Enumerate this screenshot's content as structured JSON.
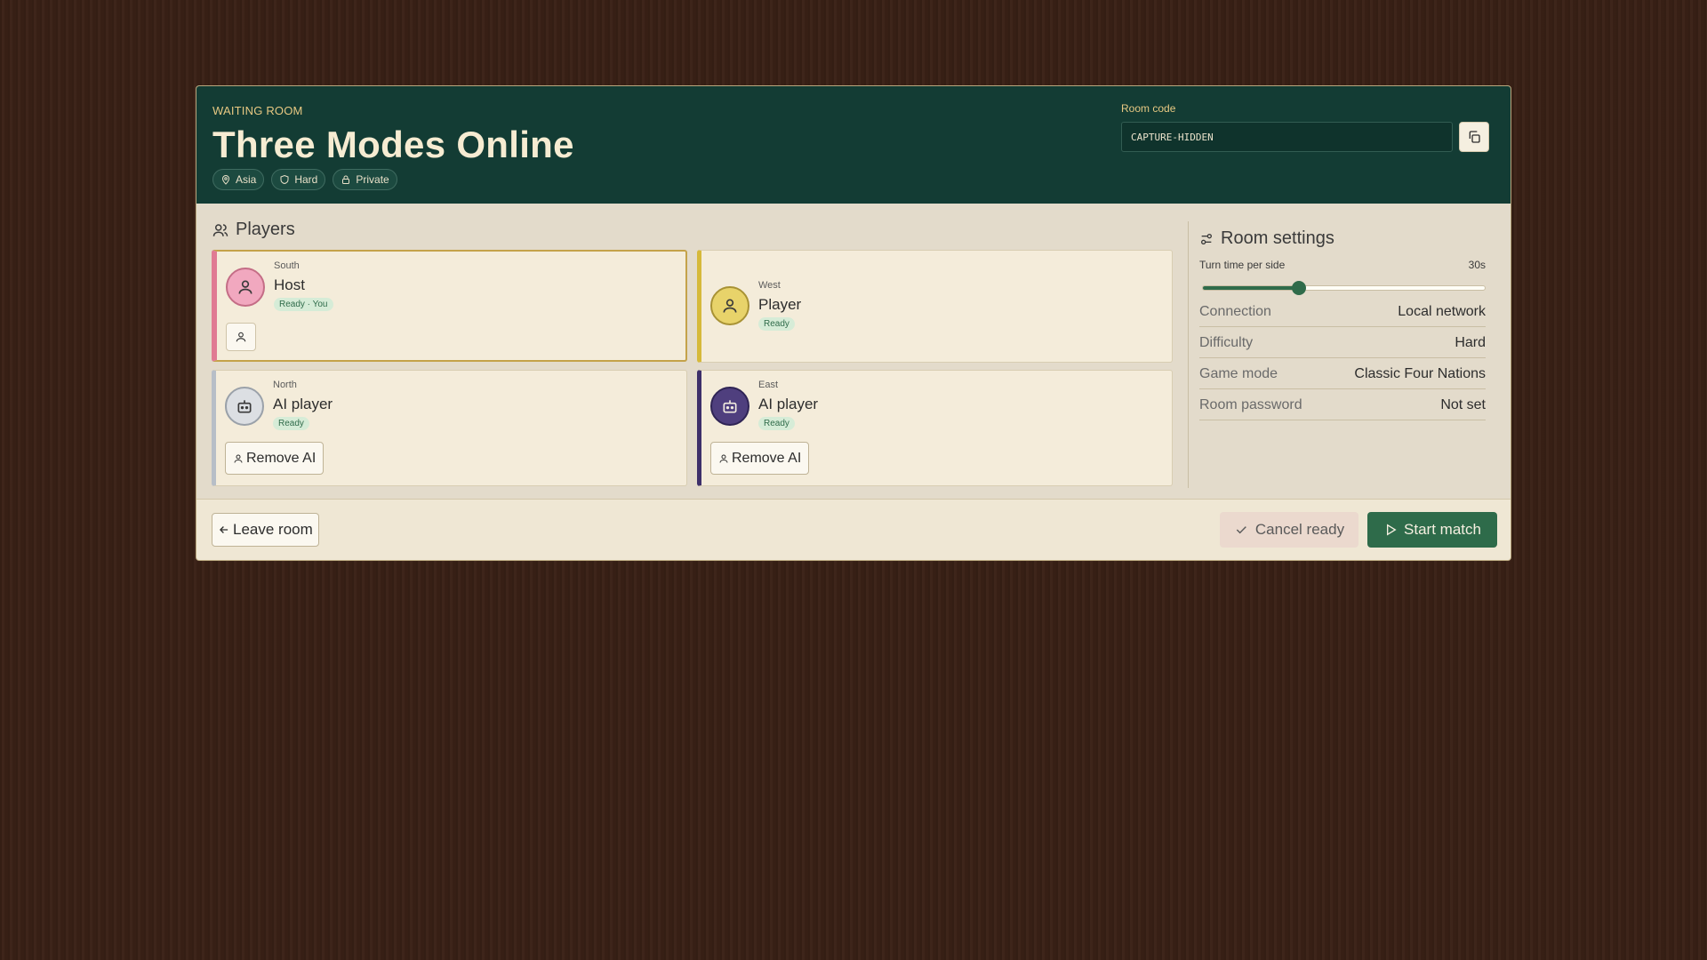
{
  "header": {
    "eyebrow": "WAITING ROOM",
    "title": "Three Modes Online",
    "chips": [
      {
        "icon": "location-pin-icon",
        "label": "Asia"
      },
      {
        "icon": "shield-icon",
        "label": "Hard"
      },
      {
        "icon": "lock-icon",
        "label": "Private"
      }
    ],
    "room_code_label": "Room code",
    "room_code_value": "CAPTURE-HIDDEN",
    "copy_icon": "copy-icon"
  },
  "players": {
    "heading": "Players",
    "seats": [
      {
        "seat": "South",
        "name": "Host",
        "status": "Ready · You",
        "avatar_color": "#f1a8bf",
        "accent": "#e07a93"
      },
      {
        "seat": "West",
        "name": "Player",
        "status": "Ready",
        "avatar_color": "#e8d36a",
        "accent": "#d6b93a"
      },
      {
        "seat": "North",
        "name": "AI player",
        "status": "Ready",
        "avatar_color": "#dcdfe3",
        "accent": "#b7bec7",
        "action": "Remove AI"
      },
      {
        "seat": "East",
        "name": "AI player",
        "status": "Ready",
        "avatar_color": "#4f3f7e",
        "accent": "#3d2f6a",
        "action": "Remove AI"
      }
    ]
  },
  "settings": {
    "heading": "Room settings",
    "turn_time_label": "Turn time per side",
    "turn_time_value": "30s",
    "turn_time_fraction": 0.34,
    "rows": [
      {
        "key": "Connection",
        "value": "Local network"
      },
      {
        "key": "Difficulty",
        "value": "Hard"
      },
      {
        "key": "Game mode",
        "value": "Classic Four Nations"
      },
      {
        "key": "Room password",
        "value": "Not set"
      }
    ]
  },
  "footer": {
    "leave_label": "Leave room",
    "cancel_label": "Cancel ready",
    "start_label": "Start match"
  },
  "colors": {
    "header_bg": "#133c34",
    "primary_green": "#2e6b4a",
    "accent_gold": "#e7c882"
  }
}
